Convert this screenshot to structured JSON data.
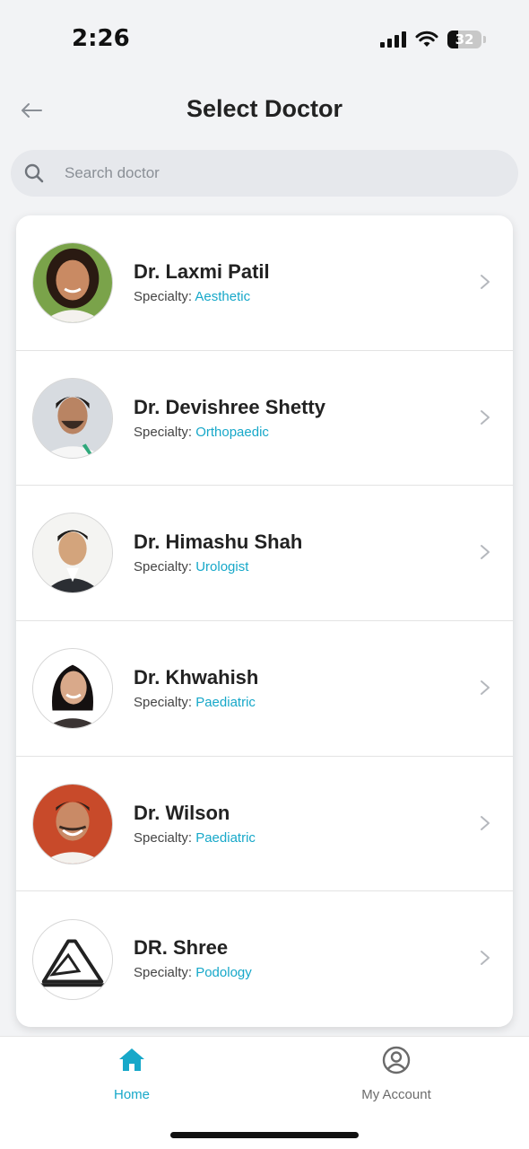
{
  "status_bar": {
    "time": "2:26",
    "battery": "32"
  },
  "header": {
    "title": "Select Doctor",
    "back_icon": "arrow-left-icon"
  },
  "search": {
    "placeholder": "Search doctor",
    "value": "",
    "icon": "search-icon"
  },
  "specialty_prefix": "Specialty: ",
  "doctors": [
    {
      "name": "Dr. Laxmi Patil",
      "specialty": "Aesthetic"
    },
    {
      "name": "Dr. Devishree Shetty",
      "specialty": "Orthopaedic"
    },
    {
      "name": "Dr. Himashu Shah",
      "specialty": "Urologist"
    },
    {
      "name": "Dr. Khwahish",
      "specialty": "Paediatric"
    },
    {
      "name": "Dr. Wilson",
      "specialty": "Paediatric"
    },
    {
      "name": "DR. Shree",
      "specialty": "Podology"
    }
  ],
  "tabbar": {
    "home_label": "Home",
    "account_label": "My Account"
  },
  "colors": {
    "accent": "#17a8c9",
    "background": "#f2f3f5",
    "card": "#ffffff"
  }
}
